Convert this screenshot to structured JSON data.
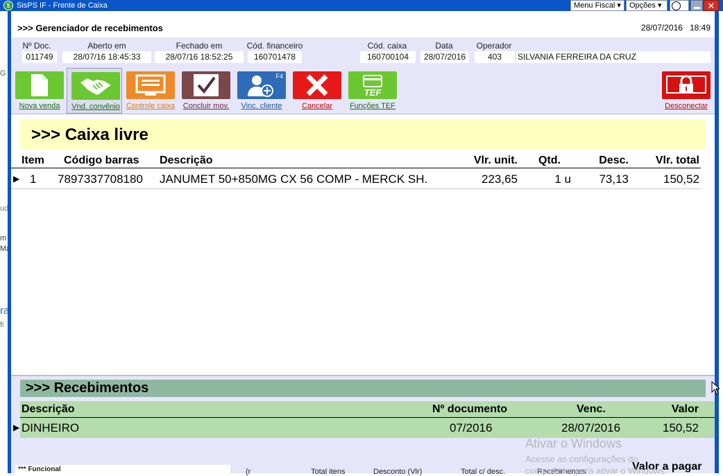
{
  "window": {
    "title": "SisPS IF - Frente de Caixa",
    "menu_fiscal": "Menu Fiscal",
    "opcoes": "Opções",
    "help": "?"
  },
  "header": {
    "title": ">>> Gerenciador de recebimentos",
    "date": "28/07/2016",
    "time": "18:49"
  },
  "info": [
    {
      "label": "Nº Doc.",
      "value": "011749"
    },
    {
      "label": "Aberto em",
      "value": "28/07/16 18:45:33"
    },
    {
      "label": "Fechado em",
      "value": "28/07/16 18:52:25"
    },
    {
      "label": "Cód. financeiro",
      "value": "160701478"
    },
    {
      "label": "Cód. caixa",
      "value": "160700104"
    },
    {
      "label": "Data",
      "value": "28/07/2016"
    },
    {
      "label": "Operador",
      "value": "403",
      "name": "SILVANIA FERREIRA DA CRUZ"
    }
  ],
  "toolbar": [
    {
      "label": "Nova venda",
      "color": "#6cc832",
      "text_color": "#1a6a10"
    },
    {
      "label": "Vnd. convênio",
      "color": "#6cc832",
      "text_color": "#1a6a10"
    },
    {
      "label": "Controle caixa",
      "color": "#f08a28",
      "text_color": "#e07810"
    },
    {
      "label": "Concluir mov.",
      "color": "#7a4848",
      "text_color": "#6a2838"
    },
    {
      "label": "Vinc. cliente",
      "color": "#2e6cb8",
      "text_color": "#2050a0",
      "badge": "F4"
    },
    {
      "label": "Cancelar",
      "color": "#e81818",
      "text_color": "#c80000"
    },
    {
      "label": "Funções TEF",
      "color": "#6cc832",
      "text_color": "#1a6a10",
      "badge": "TEF"
    },
    {
      "label": "Desconectar",
      "color": "#d81010",
      "text_color": "#c80000"
    }
  ],
  "caixa": {
    "title": ">>> Caixa livre"
  },
  "items": {
    "headers": [
      "Item",
      "Código barras",
      "Descrição",
      "Vlr. unit.",
      "Qtd.",
      "Desc.",
      "Vlr. total"
    ],
    "rows": [
      [
        "1",
        "7897337708180",
        "JANUMET 50+850MG CX 56 COMP - MERCK SH.",
        "223,65",
        "1 u",
        "73,13",
        "150,52"
      ]
    ]
  },
  "recebimentos": {
    "title": ">>> Recebimentos",
    "headers": [
      "Descrição",
      "Nº documento",
      "Venc.",
      "Valor"
    ],
    "rows": [
      [
        "DINHEIRO",
        "07/2016",
        "28/07/2016",
        "150,52"
      ]
    ]
  },
  "footer": {
    "panel": "*** Funcional",
    "labels": [
      "(r",
      "Total itens",
      "Desconto (Vlr)",
      "Total c/ desc.",
      "Recebimentos"
    ],
    "valor_pagar": "Valor a pagar"
  },
  "watermark": {
    "line1": "Ativar o Windows",
    "line2": "Acesse as configurações do",
    "line3": "computador para ativar o Windows."
  },
  "background": {
    "g": "G",
    "ud": "ud",
    "m": "m",
    "ma": "Ma",
    "r": "ra",
    "fi": "fi"
  }
}
